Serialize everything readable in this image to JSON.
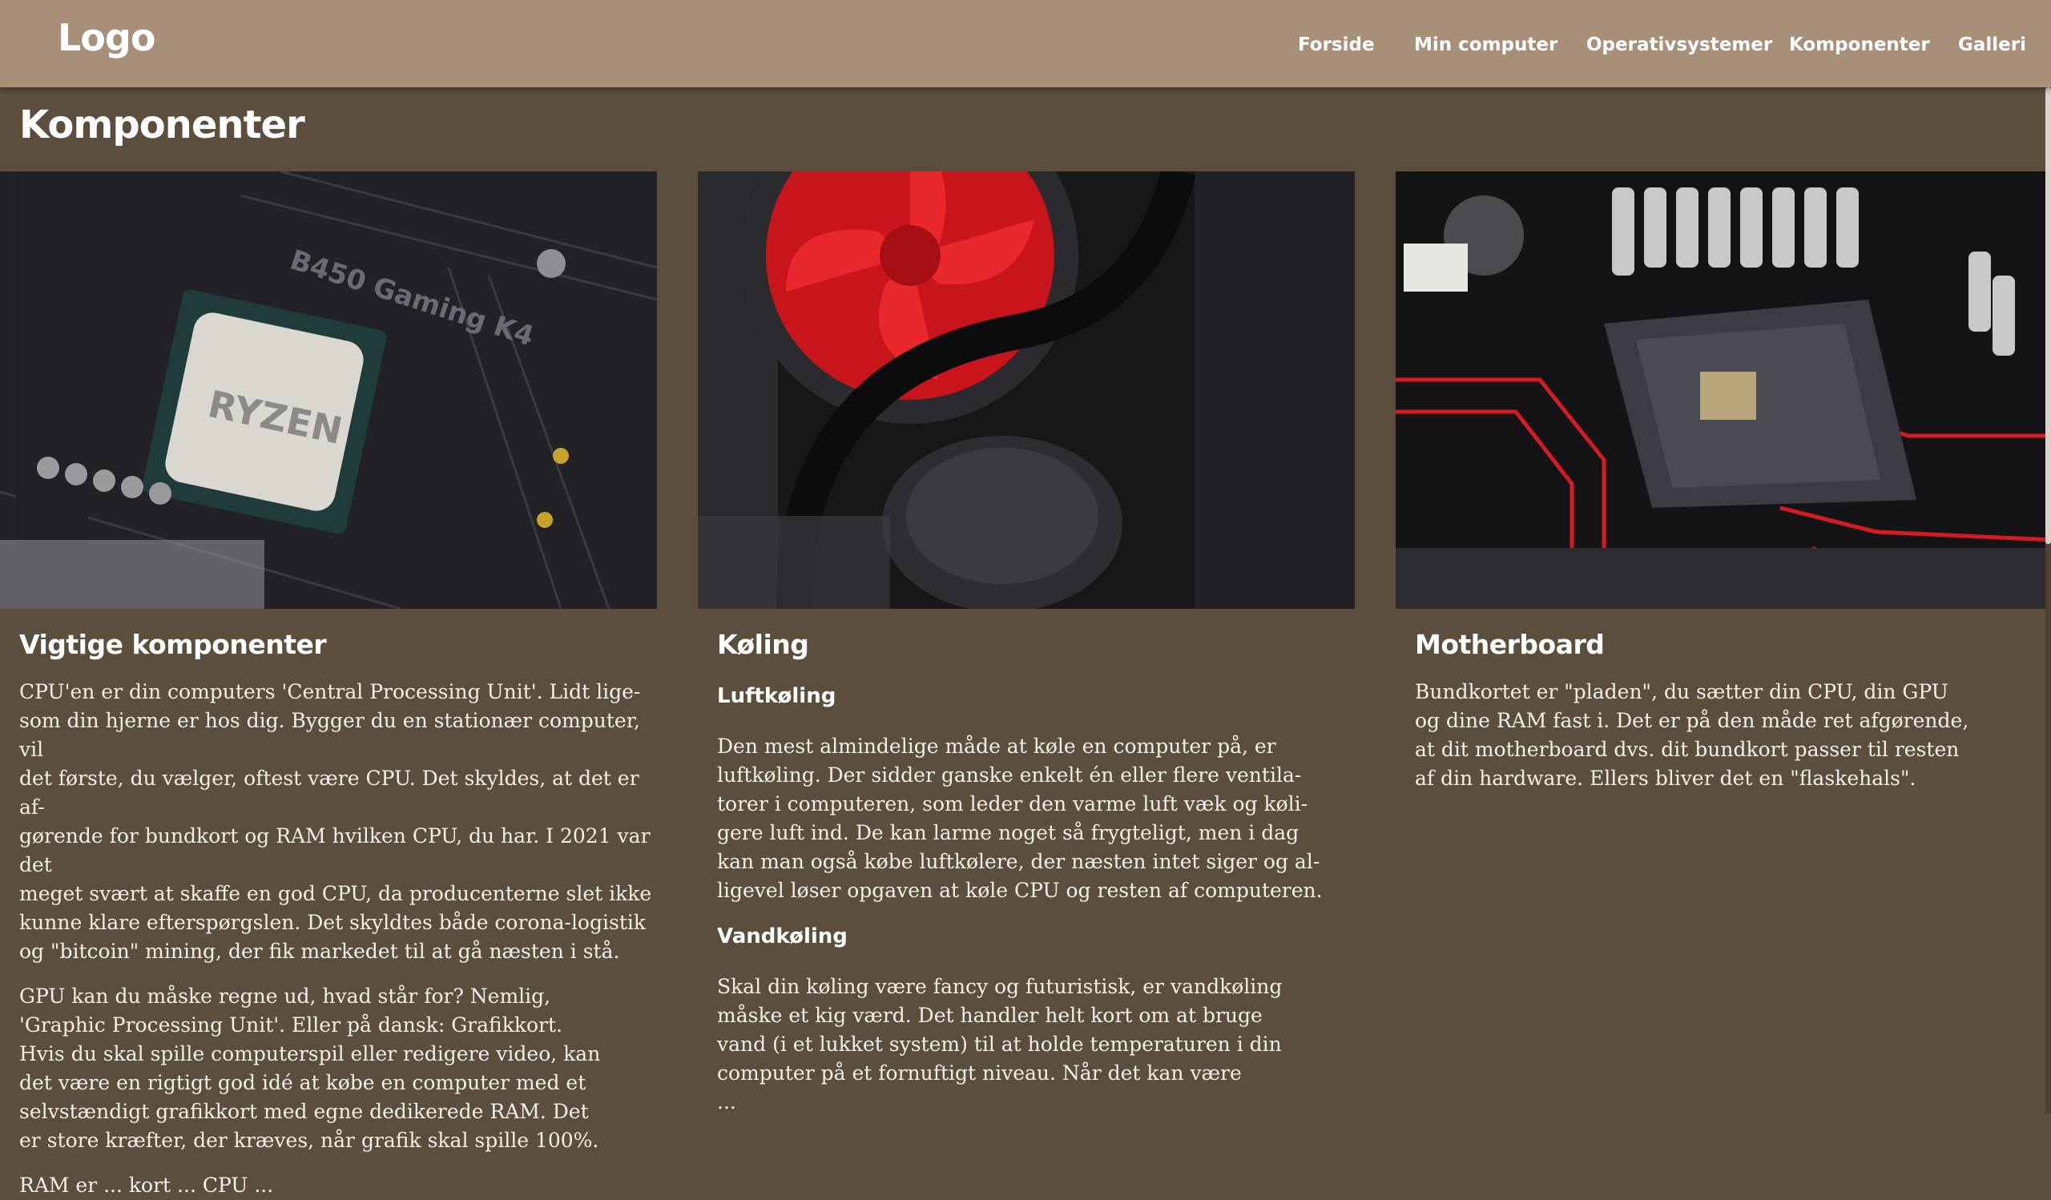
{
  "header": {
    "logo": "Logo",
    "nav": [
      "Forside",
      "Min computer",
      "Operativsystemer",
      "Komponenter",
      "Galleri"
    ]
  },
  "main": {
    "title": "Komponenter",
    "cards": [
      {
        "image": "cpu-motherboard-photo",
        "heading": "Vigtige komponenter",
        "paragraphs": [
          "CPU'en er din computers 'Central Processing Unit'. Lidt lige-\nsom din hjerne er hos dig. Bygger du en stationær computer, vil\ndet første, du vælger, oftest være CPU. Det skyldes, at det er af-\ngørende for bundkort og RAM hvilken CPU, du har. I 2021 var det\nmeget svært at skaffe en god CPU, da producenterne slet ikke\nkunne klare efterspørgslen. Det skyldtes både corona-logistik\nog \"bitcoin\" mining, der fik markedet til at gå næsten i stå.",
          "GPU kan du måske regne ud, hvad står for? Nemlig,\n'Graphic Processing Unit'. Eller på dansk: Grafikkort.\nHvis du skal spille computerspil eller redigere video, kan\ndet være en rigtigt god idé at købe en computer med et\nselvstændigt grafikkort med egne dedikerede RAM. Det\ner store kræfter, der kræves, når grafik skal spille 100%.",
          "RAM er ... kort ... CPU ... "
        ]
      },
      {
        "image": "cooling-fan-photo",
        "heading": "Køling",
        "sections": [
          {
            "subheading": "Luftkøling",
            "text": "Den mest almindelige måde at køle en computer på, er\nluftkøling. Der sidder ganske enkelt én eller flere ventila-\ntorer i computeren, som leder den varme luft væk og køli-\ngere luft ind. De kan larme noget så frygteligt, men i dag\nkan man også købe luftkølere, der næsten intet siger og al-\nligevel løser opgaven at køle CPU og resten af computeren."
          },
          {
            "subheading": "Vandkøling",
            "text": "Skal din køling være fancy og futuristisk, er vandkøling\nmåske et kig værd. Det handler helt kort om at bruge\nvand (i et lukket system) til at holde temperaturen i din\ncomputer på et fornuftigt niveau. Når det kan være\n..."
          }
        ]
      },
      {
        "image": "motherboard-socket-photo",
        "heading": "Motherboard",
        "paragraphs": [
          "Bundkortet er \"pladen\", du sætter din CPU, din GPU\nog dine RAM fast i. Det er på den måde ret afgørende,\nat dit motherboard dvs. dit bundkort passer til resten\naf din hardware. Ellers bliver det en \"flaskehals\"."
        ]
      }
    ]
  }
}
